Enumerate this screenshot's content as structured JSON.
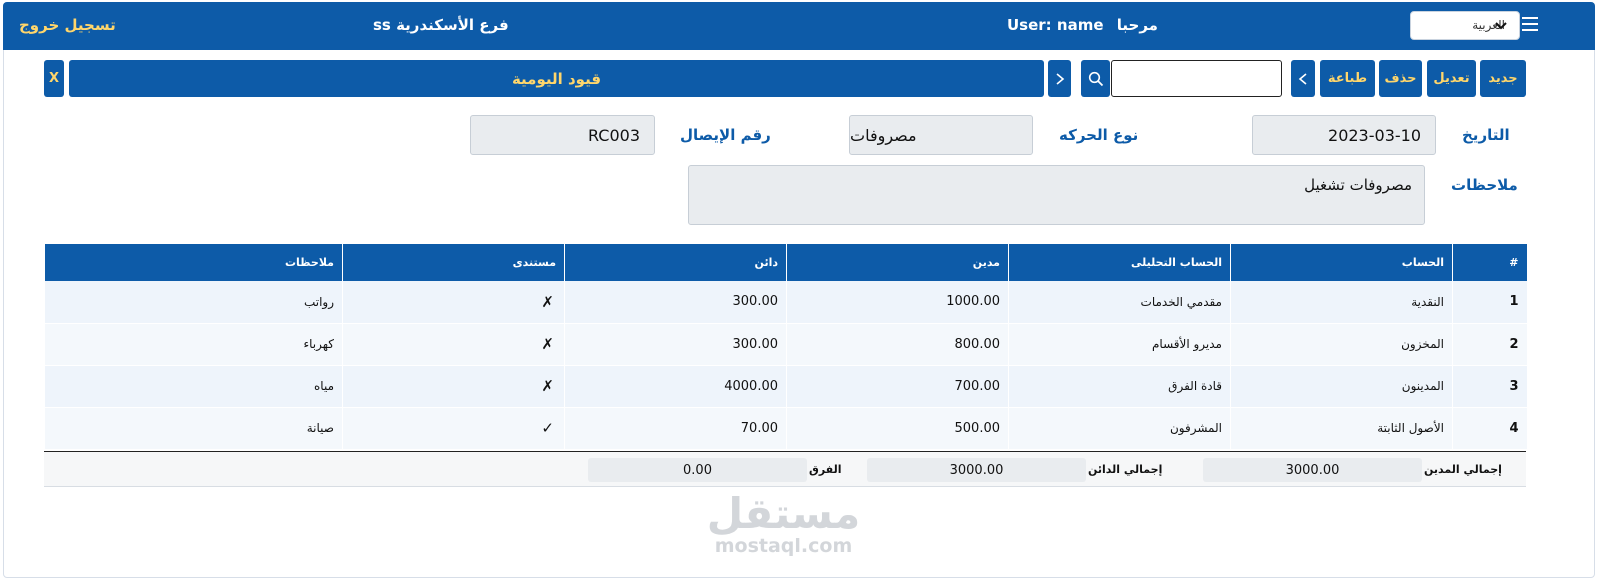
{
  "header": {
    "logout_label": "تسجيل خروج",
    "branch_label": "فرع الأسكندرية ss",
    "welcome_user": "User: name",
    "welcome_greeting": "مرحبا",
    "language_selected": "العربية"
  },
  "toolbar": {
    "close_label": "X",
    "title": "قيود اليومية",
    "search_value": "",
    "print_label": "طباعة",
    "delete_label": "حذف",
    "edit_label": "تعديل",
    "new_label": "جديد"
  },
  "form": {
    "date_label": "التاريخ",
    "date_value": "2023-03-10",
    "type_label": "نوع الحركه",
    "type_value": "مصروفات",
    "receipt_label": "رقم الإيصال",
    "receipt_value": "RC003",
    "notes_label": "ملاحظات",
    "notes_value": "مصروفات تشغيل"
  },
  "table": {
    "headers": [
      "#",
      "الحساب",
      "الحساب التحليلى",
      "مدين",
      "دائن",
      "مستندى",
      "ملاحظات"
    ],
    "rows": [
      {
        "idx": "1",
        "account": "النقدية",
        "analytic": "مقدمي الخدمات",
        "debit": "1000.00",
        "credit": "300.00",
        "documented": "✗",
        "notes": "رواتب"
      },
      {
        "idx": "2",
        "account": "المخزون",
        "analytic": "مديرو الأقسام",
        "debit": "800.00",
        "credit": "300.00",
        "documented": "✗",
        "notes": "كهرباء"
      },
      {
        "idx": "3",
        "account": "المدينون",
        "analytic": "قادة الفرق",
        "debit": "700.00",
        "credit": "4000.00",
        "documented": "✗",
        "notes": "مياه"
      },
      {
        "idx": "4",
        "account": "الأصول الثابتة",
        "analytic": "المشرفون",
        "debit": "500.00",
        "credit": "70.00",
        "documented": "✓",
        "notes": "صيانة"
      }
    ]
  },
  "totals": {
    "debit_label": "إجمالي المدين",
    "debit_value": "3000.00",
    "credit_label": "إجمالي الدائن",
    "credit_value": "3000.00",
    "diff_label": "الفرق",
    "diff_value": "0.00"
  },
  "watermark": {
    "arabic": "مستقل",
    "latin": "mostaql.com"
  },
  "colors": {
    "primary": "#0d5ba8",
    "accent": "#ffd66b"
  }
}
